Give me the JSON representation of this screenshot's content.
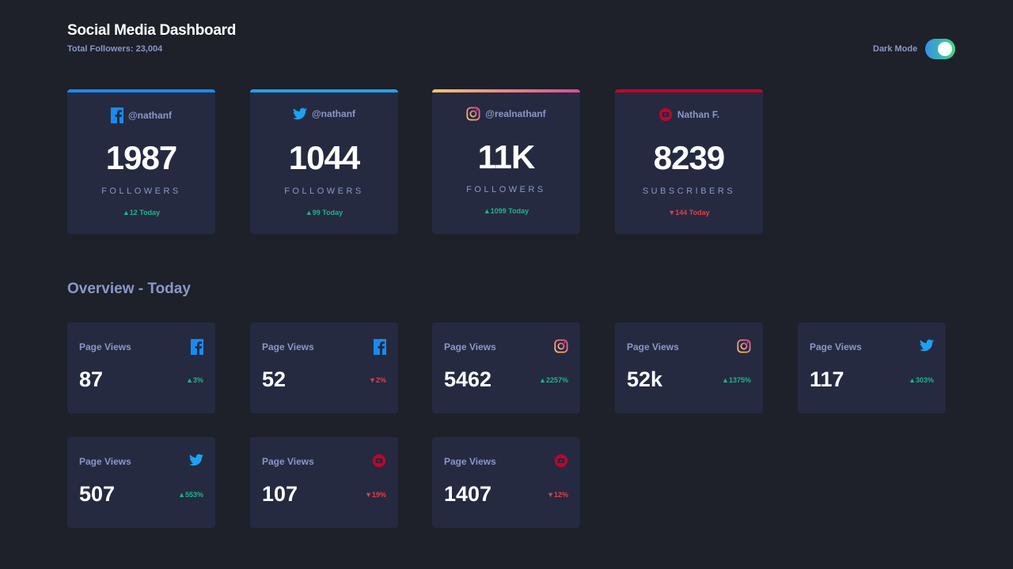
{
  "header": {
    "title": "Social Media Dashboard",
    "total_followers": "Total Followers: 23,004",
    "dark_mode_label": "Dark Mode"
  },
  "accent_colors": {
    "facebook": "#178bf2",
    "twitter": "#1da1f2",
    "instagram_from": "#fdc468",
    "instagram_to": "#df4996",
    "youtube": "#c4032a",
    "up": "#1db489",
    "down": "#dc414c"
  },
  "top_cards": [
    {
      "platform_icon": "facebook-icon",
      "handle": "@nathanf",
      "count": "1987",
      "unit": "FOLLOWERS",
      "change": "▲12 Today",
      "direction": "up"
    },
    {
      "platform_icon": "twitter-icon",
      "handle": "@nathanf",
      "count": "1044",
      "unit": "FOLLOWERS",
      "change": "▲99 Today",
      "direction": "up"
    },
    {
      "platform_icon": "instagram-icon",
      "handle": "@realnathanf",
      "count": "11K",
      "unit": "FOLLOWERS",
      "change": "▲1099 Today",
      "direction": "up"
    },
    {
      "platform_icon": "youtube-icon",
      "handle": "Nathan F.",
      "count": "8239",
      "unit": "SUBSCRIBERS",
      "change": "▼144 Today",
      "direction": "down"
    }
  ],
  "overview": {
    "title": "Overview - Today",
    "cards": [
      {
        "label": "Page Views",
        "platform_icon": "facebook-icon",
        "value": "87",
        "change": "▲3%",
        "direction": "up"
      },
      {
        "label": "Page Views",
        "platform_icon": "facebook-icon",
        "value": "52",
        "change": "▼2%",
        "direction": "down"
      },
      {
        "label": "Page Views",
        "platform_icon": "instagram-icon",
        "value": "5462",
        "change": "▲2257%",
        "direction": "up"
      },
      {
        "label": "Page Views",
        "platform_icon": "instagram-icon",
        "value": "52k",
        "change": "▲1375%",
        "direction": "up"
      },
      {
        "label": "Page Views",
        "platform_icon": "twitter-icon",
        "value": "117",
        "change": "▲303%",
        "direction": "up"
      },
      {
        "label": "Page Views",
        "platform_icon": "twitter-icon",
        "value": "507",
        "change": "▲553%",
        "direction": "up"
      },
      {
        "label": "Page Views",
        "platform_icon": "youtube-icon",
        "value": "107",
        "change": "▼19%",
        "direction": "down"
      },
      {
        "label": "Page Views",
        "platform_icon": "youtube-icon",
        "value": "1407",
        "change": "▼12%",
        "direction": "down"
      }
    ]
  }
}
